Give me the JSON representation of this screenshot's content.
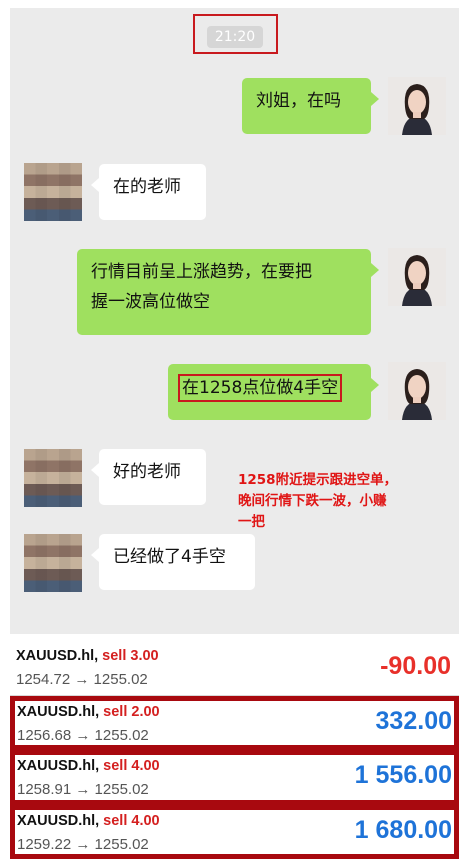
{
  "chat": {
    "time": "21:20",
    "messages": [
      {
        "side": "self",
        "text": "刘姐，在吗"
      },
      {
        "side": "other",
        "text": "在的老师"
      },
      {
        "side": "self",
        "line1": "行情目前呈上涨趋势，在要把",
        "line2": "握一波高位做空"
      },
      {
        "side": "self",
        "text": "在1258点位做4手空"
      },
      {
        "side": "other",
        "text": "好的老师"
      },
      {
        "side": "other",
        "text": "已经做了4手空"
      }
    ]
  },
  "annotation": {
    "line1": "1258附近提示跟进空单，",
    "line2": "晚间行情下跌一波，小赚",
    "line3": "一把"
  },
  "trades": [
    {
      "symbol": "XAUUSD.hl,",
      "side": "sell 3.00",
      "prices": "1254.72 → 1255.02",
      "profit": "-90.00",
      "profit_color": "#e8302a"
    },
    {
      "symbol": "XAUUSD.hl,",
      "side": "sell 2.00",
      "prices": "1256.68 → 1255.02",
      "profit": "332.00",
      "profit_color": "#1e73d8"
    },
    {
      "symbol": "XAUUSD.hl,",
      "side": "sell 4.00",
      "prices": "1258.91 → 1255.02",
      "profit": "1 556.00",
      "profit_color": "#1e73d8"
    },
    {
      "symbol": "XAUUSD.hl,",
      "side": "sell 4.00",
      "prices": "1259.22 → 1255.02",
      "profit": "1 680.00",
      "profit_color": "#1e73d8"
    }
  ],
  "colors": {
    "bubble_self": "#9fe05f",
    "annotation": "#e01515",
    "highlight_box": "#c8191e"
  }
}
